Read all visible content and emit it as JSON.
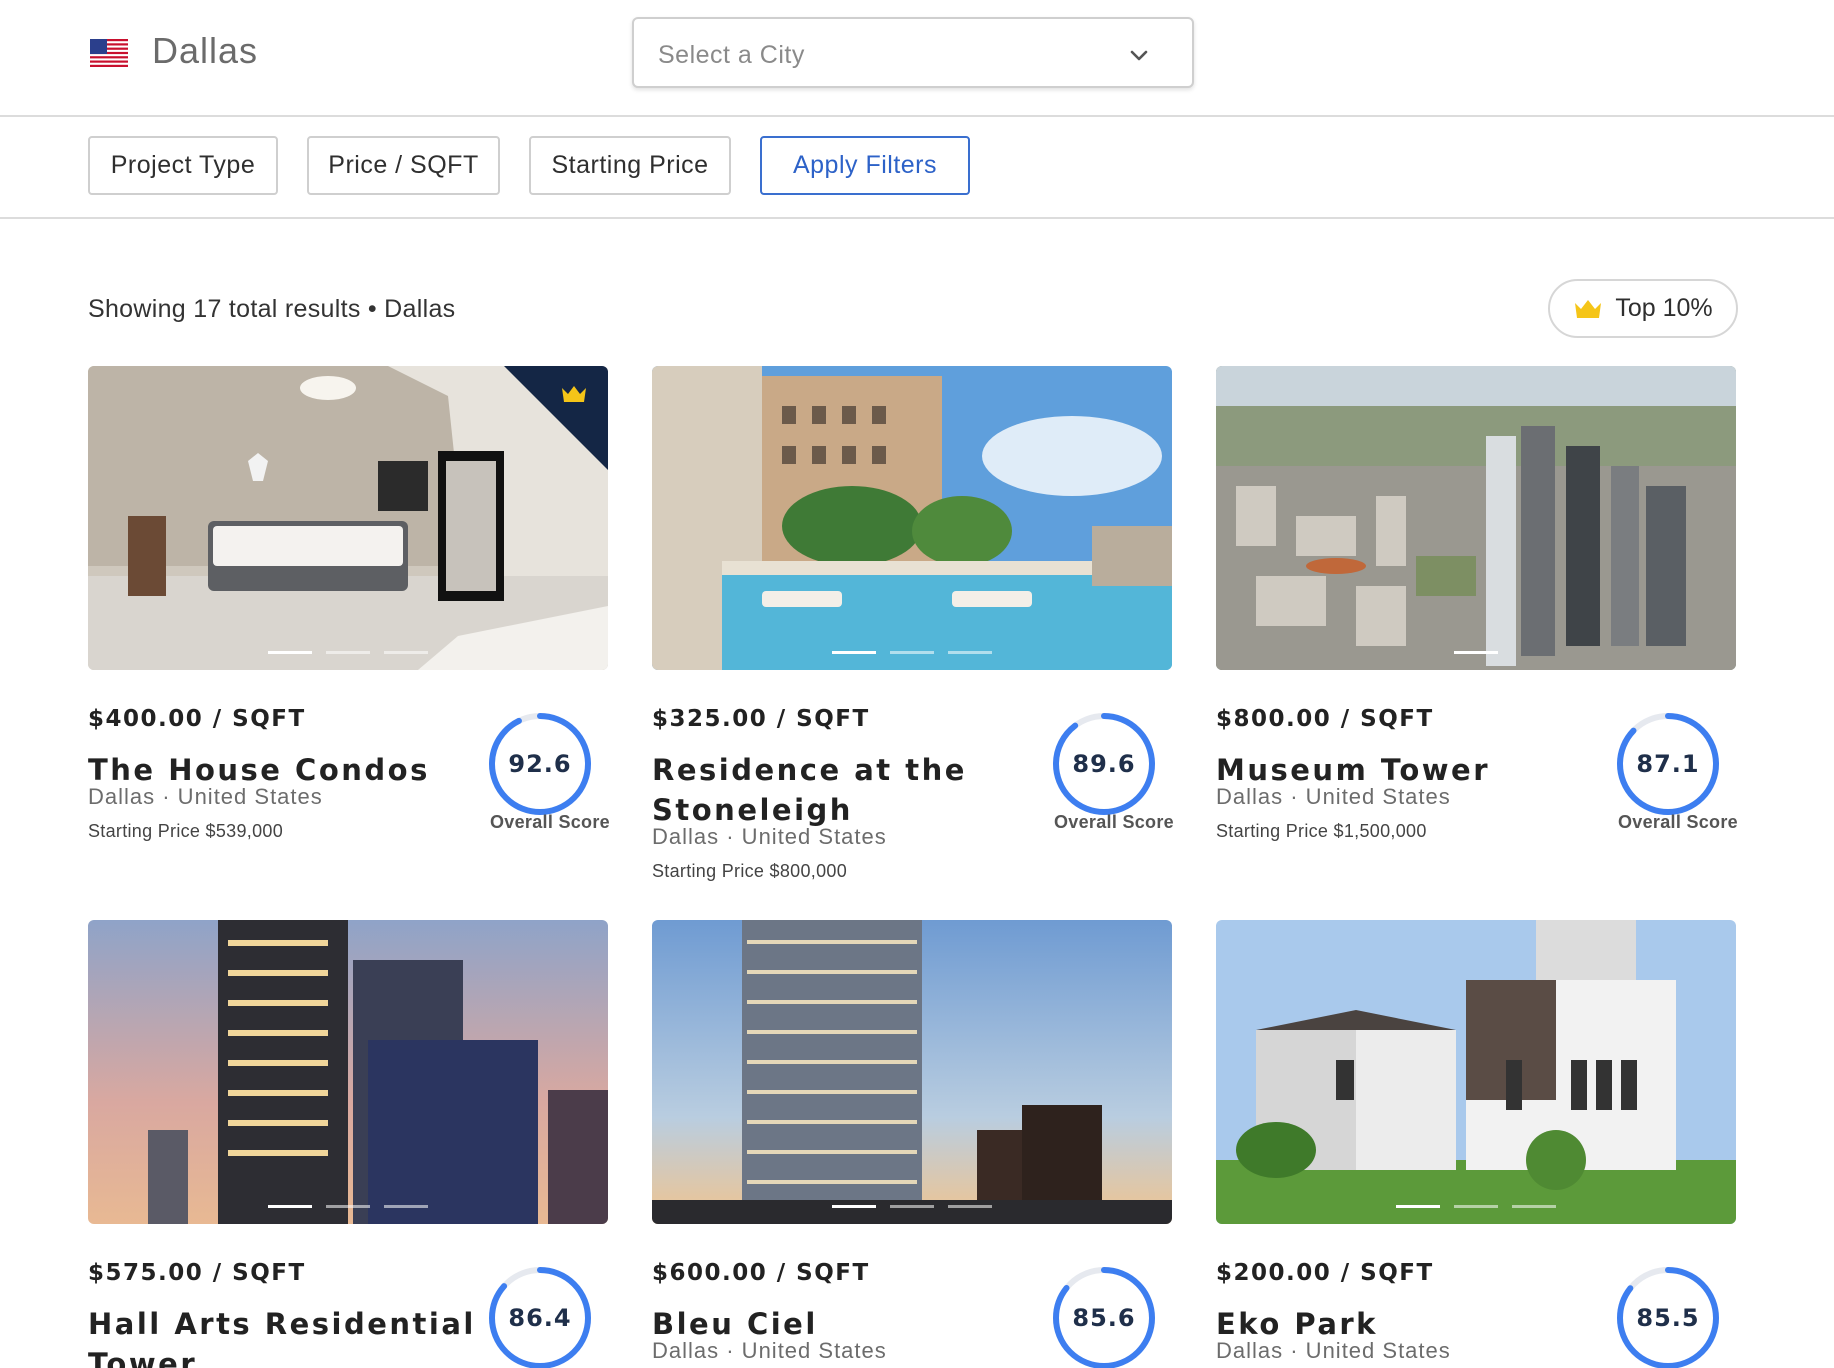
{
  "header": {
    "flag_icon": "us-flag-icon",
    "city": "Dallas",
    "city_select_placeholder": "Select a City"
  },
  "filters": {
    "project_type": "Project Type",
    "price_sqft": "Price / SQFT",
    "starting_price": "Starting Price",
    "apply": "Apply Filters"
  },
  "results": {
    "summary": "Showing 17 total results • Dallas",
    "top_toggle": "Top 10%"
  },
  "colors": {
    "accent_blue": "#2d62c8",
    "score_ring": "#3d7ef0",
    "crown_gold": "#f5c518",
    "corner_navy": "#142645"
  },
  "listings": [
    {
      "price": "$400.00 / SQFT",
      "title": "The House Condos",
      "location": "Dallas · United States",
      "starting_price": "Starting Price $539,000",
      "score": "92.6",
      "score_value": 92.6,
      "score_label": "Overall Score",
      "top_badge": true,
      "image_slides": 3,
      "active_slide": 1
    },
    {
      "price": "$325.00 / SQFT",
      "title": "Residence at the Stoneleigh",
      "location": "Dallas · United States",
      "starting_price": "Starting Price $800,000",
      "score": "89.6",
      "score_value": 89.6,
      "score_label": "Overall Score",
      "top_badge": false,
      "image_slides": 3,
      "active_slide": 1
    },
    {
      "price": "$800.00 / SQFT",
      "title": "Museum Tower",
      "location": "Dallas · United States",
      "starting_price": "Starting Price $1,500,000",
      "score": "87.1",
      "score_value": 87.1,
      "score_label": "Overall Score",
      "top_badge": false,
      "image_slides": 1,
      "active_slide": 1
    },
    {
      "price": "$575.00 / SQFT",
      "title": "Hall Arts Residential Tower",
      "score": "86.4",
      "score_value": 86.4,
      "top_badge": false,
      "image_slides": 3,
      "active_slide": 1
    },
    {
      "price": "$600.00 / SQFT",
      "title": "Bleu Ciel",
      "location": "Dallas · United States",
      "score": "85.6",
      "score_value": 85.6,
      "top_badge": false,
      "image_slides": 3,
      "active_slide": 1
    },
    {
      "price": "$200.00 / SQFT",
      "title": "Eko Park",
      "location": "Dallas · United States",
      "score": "85.5",
      "score_value": 85.5,
      "top_badge": false,
      "image_slides": 3,
      "active_slide": 1
    }
  ]
}
